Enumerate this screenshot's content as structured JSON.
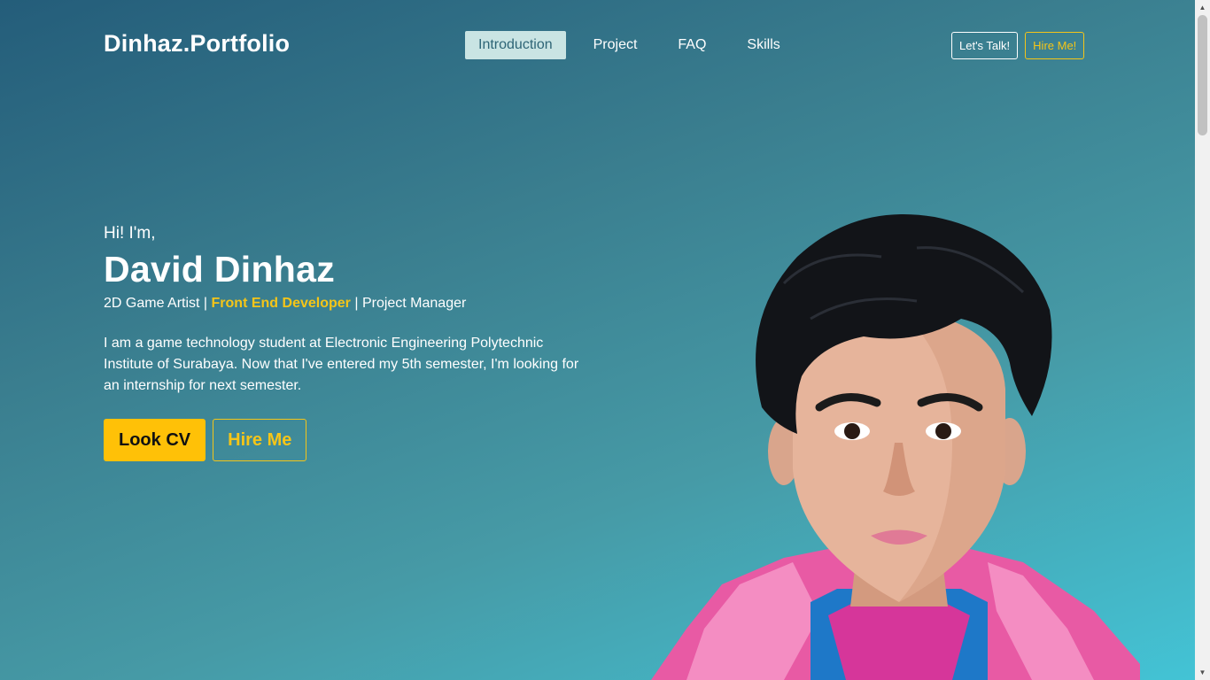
{
  "nav": {
    "logo": "Dinhaz.Portfolio",
    "items": [
      {
        "label": "Introduction",
        "active": true
      },
      {
        "label": "Project",
        "active": false
      },
      {
        "label": "FAQ",
        "active": false
      },
      {
        "label": "Skills",
        "active": false
      }
    ],
    "talk_label": "Let's Talk!",
    "hire_label": "Hire Me!"
  },
  "hero": {
    "greeting": "Hi! I'm,",
    "name": "David Dinhaz",
    "role_1": "2D Game Artist",
    "role_2": "Front End Developer",
    "role_3": "Project Manager",
    "separator": " | ",
    "description": "I am a game technology student at Electronic Engineering Polytechnic Institute of Surabaya. Now that I've entered my 5th semester, I'm looking for an internship for next semester.",
    "cv_label": "Look CV",
    "hire_label": "Hire Me"
  },
  "colors": {
    "accent": "#ffc107",
    "gradient_start": "#245d7a",
    "gradient_end": "#43c4d6",
    "active_tab_bg": "#c9e4e3"
  },
  "icons": {
    "scroll_up": "chevron-up-icon",
    "scroll_down": "chevron-down-icon"
  }
}
